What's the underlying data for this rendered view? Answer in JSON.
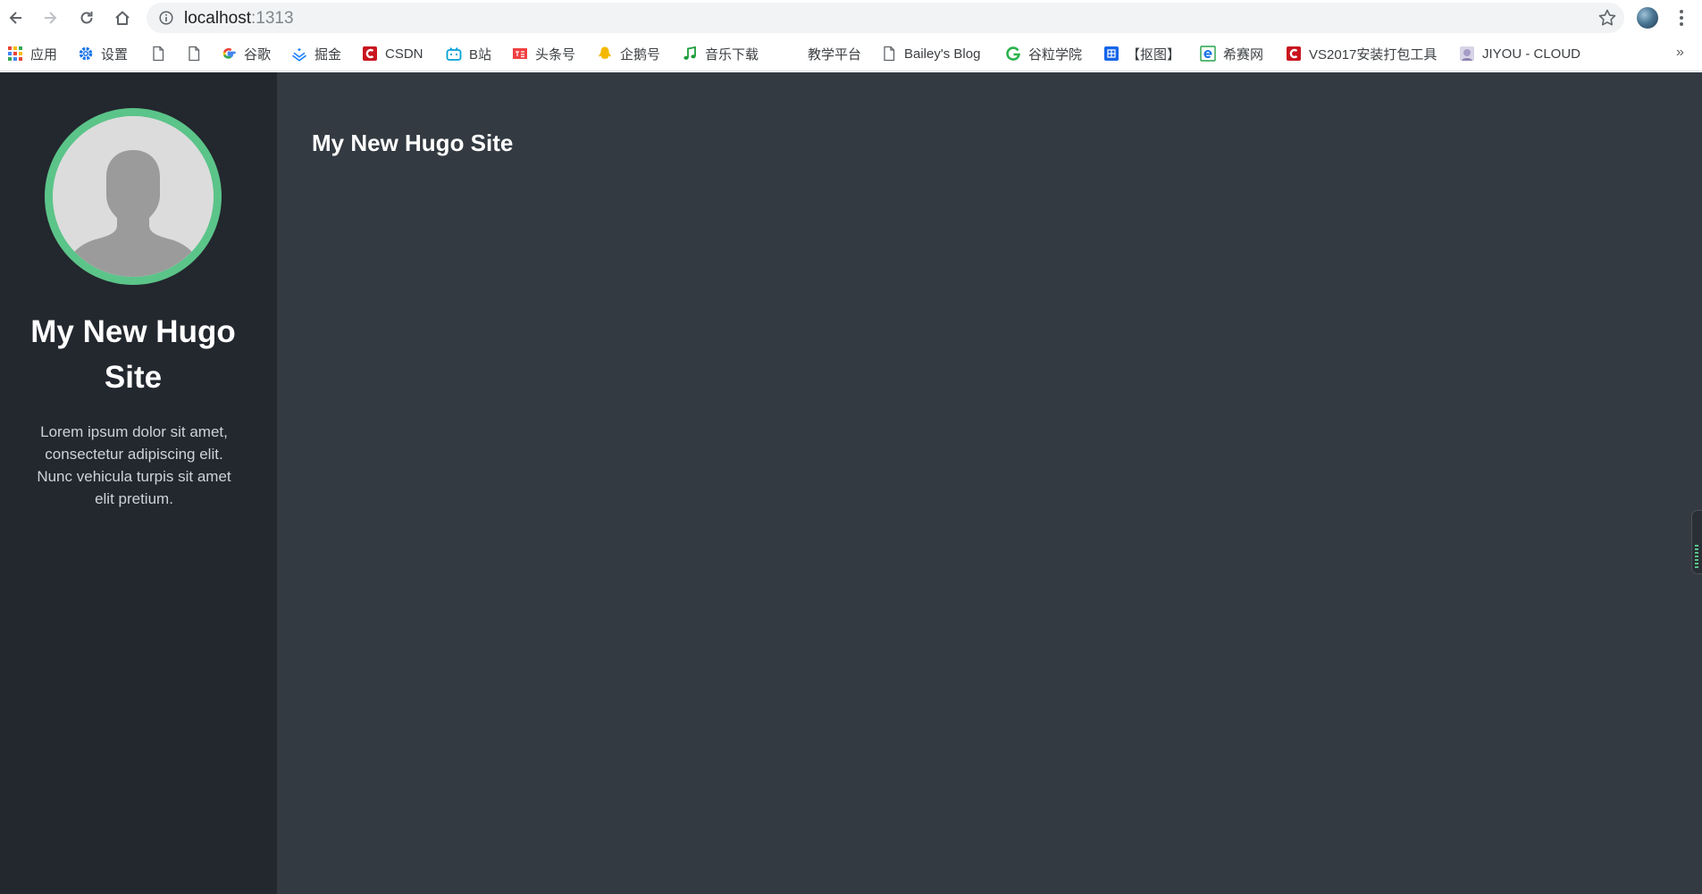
{
  "browser": {
    "url_host": "localhost",
    "url_port": ":1313",
    "bookmarks": [
      {
        "label": "应用",
        "icon": "apps-grid-icon"
      },
      {
        "label": "设置",
        "icon": "settings-gear-icon"
      },
      {
        "label": "",
        "icon": "page-icon"
      },
      {
        "label": "",
        "icon": "page-icon"
      },
      {
        "label": "谷歌",
        "icon": "google-icon"
      },
      {
        "label": "掘金",
        "icon": "juejin-icon"
      },
      {
        "label": "CSDN",
        "icon": "csdn-icon"
      },
      {
        "label": "B站",
        "icon": "bilibili-icon"
      },
      {
        "label": "头条号",
        "icon": "toutiao-icon"
      },
      {
        "label": "企鹅号",
        "icon": "qq-penguin-icon"
      },
      {
        "label": "音乐下载",
        "icon": "music-note-icon"
      },
      {
        "label": "教学平台",
        "icon": ""
      },
      {
        "label": "Bailey's Blog",
        "icon": "page-icon"
      },
      {
        "label": "谷粒学院",
        "icon": "guli-icon"
      },
      {
        "label": "【抠图】",
        "icon": "koutu-icon"
      },
      {
        "label": "希赛网",
        "icon": "ie-icon"
      },
      {
        "label": "VS2017安装打包工具",
        "icon": "csdn-icon"
      },
      {
        "label": "JIYOU - CLOUD",
        "icon": "anime-avatar-icon"
      }
    ],
    "more_label": "»"
  },
  "colors": {
    "sidebar_bg": "#23272e",
    "main_bg": "#343a41",
    "avatar_ring": "#5bc489",
    "text_light": "#ffffff"
  },
  "sidebar": {
    "title": "My New Hugo Site",
    "description": "Lorem ipsum dolor sit amet, consectetur adipiscing elit. Nunc vehicula turpis sit amet elit pretium."
  },
  "main": {
    "title": "My New Hugo Site"
  }
}
